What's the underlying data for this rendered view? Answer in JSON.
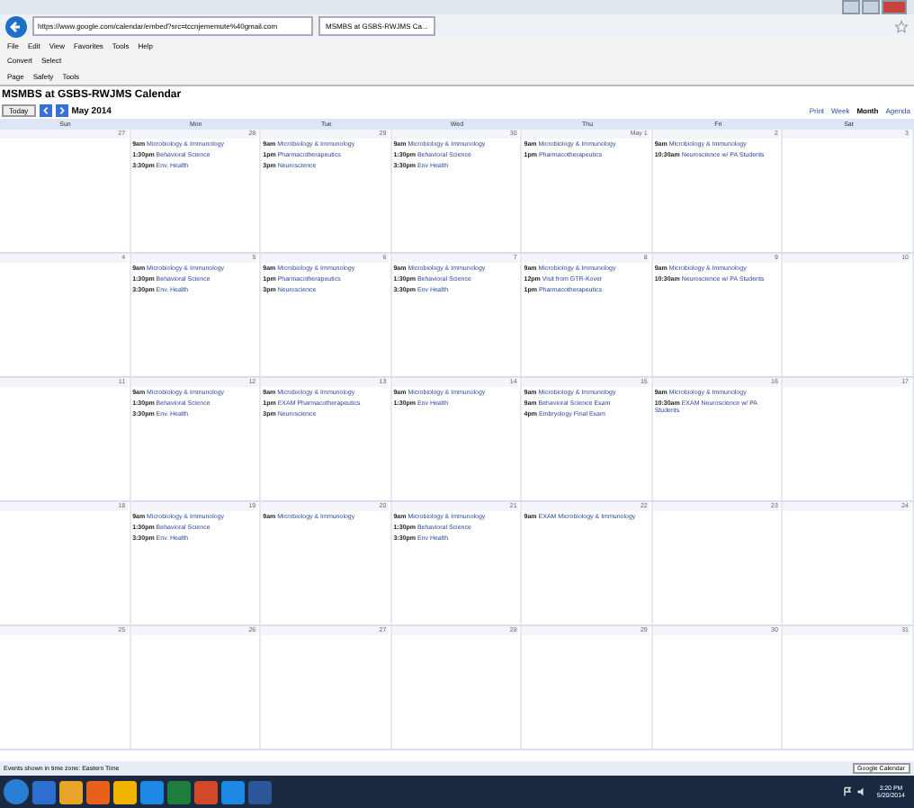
{
  "browser": {
    "address": "https://www.google.com/calendar/embed?src=tccnjememute%40gmail.com",
    "tab": "MSMBS at GSBS-RWJMS Ca...",
    "menu": [
      "File",
      "Edit",
      "View",
      "Favorites",
      "Tools",
      "Help"
    ],
    "convert": "Convert",
    "select": "Select",
    "commands": [
      "Page",
      "Safety",
      "Tools"
    ]
  },
  "calendar": {
    "title": "MSMBS at GSBS-RWJMS Calendar",
    "today": "Today",
    "month": "May 2014",
    "print": "Print",
    "views": [
      {
        "label": "Week",
        "selected": false
      },
      {
        "label": "Month",
        "selected": true
      },
      {
        "label": "Agenda",
        "selected": false
      }
    ],
    "weekdays": [
      "Sun",
      "Mon",
      "Tue",
      "Wed",
      "Thu",
      "Fri",
      "Sat"
    ],
    "weeks": [
      [
        {
          "date": "27"
        },
        {
          "date": "28",
          "events": [
            {
              "time": "9am",
              "title": "Microbiology & Immunology"
            },
            {
              "time": "1:30pm",
              "title": "Behavioral Science"
            },
            {
              "time": "3:30pm",
              "title": "Env. Health"
            }
          ]
        },
        {
          "date": "29",
          "events": [
            {
              "time": "9am",
              "title": "Microbiology & Immunology"
            },
            {
              "time": "1pm",
              "title": "Pharmacotherapeutics"
            },
            {
              "time": "3pm",
              "title": "Neuroscience"
            }
          ]
        },
        {
          "date": "30",
          "events": [
            {
              "time": "9am",
              "title": "Microbiology & Immunology"
            },
            {
              "time": "1:30pm",
              "title": "Behavioral Science"
            },
            {
              "time": "3:30pm",
              "title": "Env Health"
            }
          ]
        },
        {
          "date": "May 1",
          "events": [
            {
              "time": "9am",
              "title": "Microbiology & Immunology"
            },
            {
              "time": "1pm",
              "title": "Pharmacotherapeutics"
            }
          ]
        },
        {
          "date": "2",
          "events": [
            {
              "time": "9am",
              "title": "Microbiology & Immunology"
            },
            {
              "time": "10:30am",
              "title": "Neuroscience w/ PA Students"
            }
          ]
        },
        {
          "date": "3"
        }
      ],
      [
        {
          "date": "4"
        },
        {
          "date": "5",
          "events": [
            {
              "time": "9am",
              "title": "Microbiology & Immunology"
            },
            {
              "time": "1:30pm",
              "title": "Behavioral Science"
            },
            {
              "time": "3:30pm",
              "title": "Env. Health"
            }
          ]
        },
        {
          "date": "6",
          "events": [
            {
              "time": "9am",
              "title": "Microbiology & Immunology"
            },
            {
              "time": "1pm",
              "title": "Pharmacotherapeutics"
            },
            {
              "time": "3pm",
              "title": "Neuroscience"
            }
          ]
        },
        {
          "date": "7",
          "events": [
            {
              "time": "9am",
              "title": "Microbiology & Immunology"
            },
            {
              "time": "1:30pm",
              "title": "Behavioral Science"
            },
            {
              "time": "3:30pm",
              "title": "Env Health"
            }
          ]
        },
        {
          "date": "8",
          "events": [
            {
              "time": "9am",
              "title": "Microbiology & Immunology"
            },
            {
              "time": "12pm",
              "title": "Visit from GTR-Kover"
            },
            {
              "time": "1pm",
              "title": "Pharmacotherapeutics"
            }
          ]
        },
        {
          "date": "9",
          "events": [
            {
              "time": "9am",
              "title": "Microbiology & Immunology"
            },
            {
              "time": "10:30am",
              "title": "Neuroscience w/ PA Students"
            }
          ]
        },
        {
          "date": "10"
        }
      ],
      [
        {
          "date": "11"
        },
        {
          "date": "12",
          "events": [
            {
              "time": "9am",
              "title": "Microbiology & Immunology"
            },
            {
              "time": "1:30pm",
              "title": "Behavioral Science"
            },
            {
              "time": "3:30pm",
              "title": "Env. Health"
            }
          ]
        },
        {
          "date": "13",
          "events": [
            {
              "time": "9am",
              "title": "Microbiology & Immunology"
            },
            {
              "time": "1pm",
              "title": "EXAM Pharmacotherapeutics"
            },
            {
              "time": "3pm",
              "title": "Neuroscience"
            }
          ]
        },
        {
          "date": "14",
          "events": [
            {
              "time": "9am",
              "title": "Microbiology & Immunology"
            },
            {
              "time": "1:30pm",
              "title": "Env Health"
            }
          ]
        },
        {
          "date": "15",
          "events": [
            {
              "time": "9am",
              "title": "Microbiology & Immunology"
            },
            {
              "time": "9am",
              "title": "Behavioral Science Exam"
            },
            {
              "time": "4pm",
              "title": "Embryology Final Exam"
            }
          ]
        },
        {
          "date": "16",
          "events": [
            {
              "time": "9am",
              "title": "Microbiology & Immunology"
            },
            {
              "time": "10:30am",
              "title": "EXAM Neuroscience w/ PA Students"
            }
          ]
        },
        {
          "date": "17"
        }
      ],
      [
        {
          "date": "18"
        },
        {
          "date": "19",
          "events": [
            {
              "time": "9am",
              "title": "Microbiology & Immunology"
            },
            {
              "time": "1:30pm",
              "title": "Behavioral Science"
            },
            {
              "time": "3:30pm",
              "title": "Env. Health"
            }
          ]
        },
        {
          "date": "20",
          "events": [
            {
              "time": "9am",
              "title": "Microbiology & Immunology"
            }
          ]
        },
        {
          "date": "21",
          "events": [
            {
              "time": "9am",
              "title": "Microbiology & Immunology"
            },
            {
              "time": "1:30pm",
              "title": "Behavioral Science"
            },
            {
              "time": "3:30pm",
              "title": "Env Health"
            }
          ]
        },
        {
          "date": "22",
          "events": [
            {
              "time": "9am",
              "title": "EXAM Microbiology & Immunology"
            }
          ]
        },
        {
          "date": "23"
        },
        {
          "date": "24"
        }
      ],
      [
        {
          "date": "25"
        },
        {
          "date": "26"
        },
        {
          "date": "27"
        },
        {
          "date": "28"
        },
        {
          "date": "29"
        },
        {
          "date": "30"
        },
        {
          "date": "31"
        }
      ]
    ],
    "timezone": "Events shown in time zone: Eastern Time",
    "badge": "Google Calendar"
  },
  "taskbar": {
    "time": "3:20 PM",
    "date": "5/20/2014"
  }
}
